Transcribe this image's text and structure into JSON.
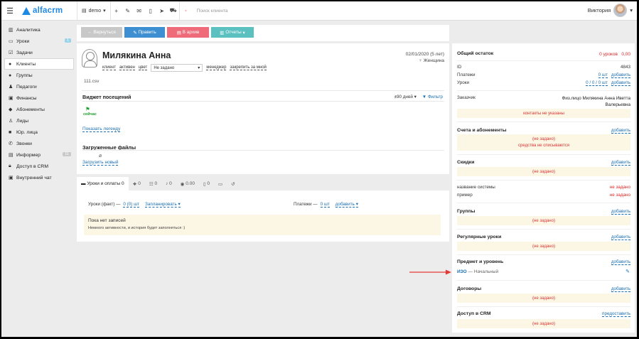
{
  "topbar": {
    "brand": "alfacrm",
    "branch": "demo",
    "search_placeholder": "Поиск клиента",
    "user_name": "Виктория"
  },
  "sidebar": {
    "items": [
      {
        "label": "Аналитика",
        "icon": "chart-icon",
        "badge": ""
      },
      {
        "label": "Уроки",
        "icon": "calendar-icon",
        "badge": "1"
      },
      {
        "label": "Задачи",
        "icon": "tasks-icon",
        "badge": ""
      },
      {
        "label": "Клиенты",
        "icon": "user-icon",
        "badge": "",
        "active": true
      },
      {
        "label": "Группы",
        "icon": "users-icon",
        "badge": ""
      },
      {
        "label": "Педагоги",
        "icon": "teacher-icon",
        "badge": ""
      },
      {
        "label": "Финансы",
        "icon": "money-icon",
        "badge": ""
      },
      {
        "label": "Абонементы",
        "icon": "tag-icon",
        "badge": ""
      },
      {
        "label": "Лиды",
        "icon": "lead-icon",
        "badge": ""
      },
      {
        "label": "Юр. лица",
        "icon": "briefcase-icon",
        "badge": ""
      },
      {
        "label": "Звонки",
        "icon": "phone-icon",
        "badge": ""
      },
      {
        "label": "Информер",
        "icon": "informer-icon",
        "badge": "11"
      },
      {
        "label": "Доступ в CRM",
        "icon": "lock-icon",
        "badge": ""
      },
      {
        "label": "Внутренний чат",
        "icon": "chat-icon",
        "badge": ""
      }
    ]
  },
  "actions": {
    "back": "Вернуться",
    "edit": "Править",
    "archive": "В архив",
    "reports": "Отчеты"
  },
  "client": {
    "name": "Милякина Анна",
    "client_label": "клиент",
    "status_label": "активен",
    "color_label": "цвет",
    "select_value": "Не задано",
    "manager_label": "менеджер",
    "pin_label": "закрепить за мной",
    "birthdate": "02/01/2020 (5 лет)",
    "gender": "Женщина",
    "file_note": "111.csv"
  },
  "visits": {
    "title": "Виджет посещений",
    "period": "±90 дней",
    "filter": "Фильтр",
    "now_label": "сейчас",
    "legend_link": "Показать легенду"
  },
  "files": {
    "title": "Загруженные файлы",
    "upload": "Загрузить новый"
  },
  "tabs": [
    {
      "label": "Уроки и оплаты 0",
      "icon": "lessons-icon"
    },
    {
      "label": "0",
      "icon": "comments-icon"
    },
    {
      "label": "0",
      "icon": "list-icon"
    },
    {
      "label": "0",
      "icon": "contacts-icon"
    },
    {
      "label": "0.00",
      "icon": "money-icon"
    },
    {
      "label": "0",
      "icon": "docs-icon"
    },
    {
      "label": "",
      "icon": "card-icon"
    },
    {
      "label": "",
      "icon": "history-icon"
    }
  ],
  "lessons": {
    "fact_label": "Уроки (факт) —",
    "fact_value": "0 (0) шт",
    "plan": "Запланировать",
    "payments_label": "Платежи —",
    "payments_value": "0 шт",
    "add": "добавить",
    "empty_title": "Пока нет записей",
    "empty_text": "Немного активности, и история будет заполняться :)"
  },
  "right": {
    "balance_title": "Общий остаток",
    "balance_value": "0 уроков   0,00",
    "id_label": "ID",
    "id_value": "4843",
    "payments_label": "Платежи",
    "payments_value": "0 шт",
    "payments_add": "добавить",
    "lessons_label": "Уроки",
    "lessons_value": "0 / 0 / 0 шт",
    "lessons_add": "добавить",
    "customer_label": "Заказчик",
    "customer_value": "Физ.лицо Милякина Анна Иветта Валерьевна",
    "contacts_missing": "контакты не указаны",
    "accounts_title": "Счета и абонементы",
    "accounts_add": "добавить",
    "not_set": "(не задано)",
    "no_debit": "средства не списываются",
    "discounts_title": "Скидки",
    "discounts_add": "добавить",
    "sys_name_label": "название системы",
    "sys_name_value": "не задано",
    "example_label": "пример",
    "example_value": "не задано",
    "groups_title": "Группы",
    "groups_add": "добавить",
    "regular_title": "Регулярные уроки",
    "regular_add": "добавить",
    "subject_title": "Предмет и уровень",
    "subject_add": "добавить",
    "subject_name": "ИЗО",
    "subject_level": "— Начальный",
    "contracts_title": "Договоры",
    "contracts_add": "добавить",
    "access_title": "Доступ в CRM",
    "access_link": "предоставить"
  },
  "colors": {
    "accent": "#1e88e5",
    "btn_back": "#c8c8c8",
    "btn_edit": "#3d8fd1",
    "btn_archive": "#ef6b7a",
    "btn_reports": "#5bc0c0",
    "arrow": "#e53935"
  }
}
